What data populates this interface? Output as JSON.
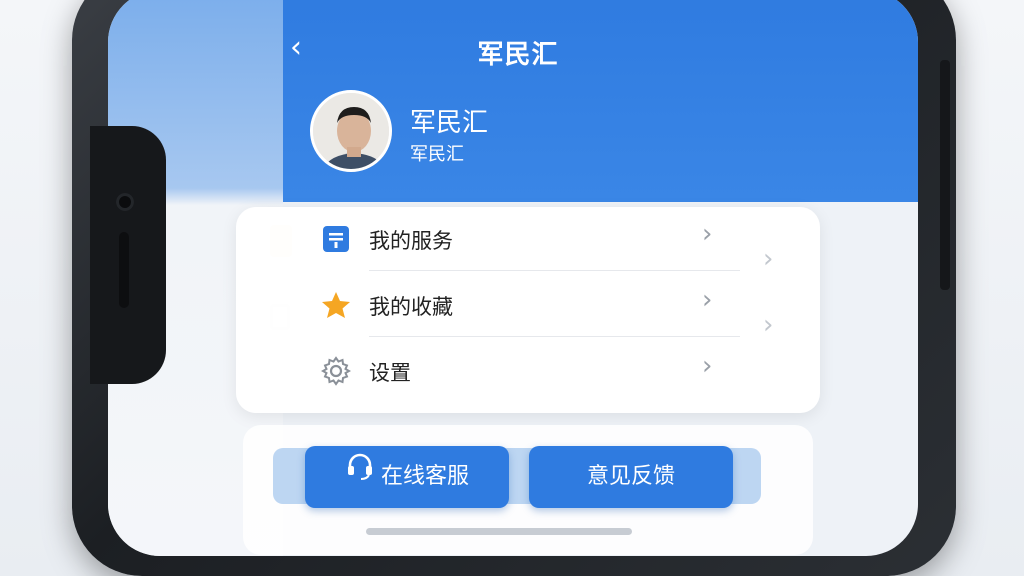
{
  "header": {
    "back_glyph": "‹",
    "title": "军民汇"
  },
  "profile": {
    "name": "军民汇",
    "subtitle": "军民汇"
  },
  "menu": {
    "items": [
      {
        "label": "我的服务",
        "icon": "service-list-icon",
        "chevron": "›"
      },
      {
        "label": "我的收藏",
        "icon": "star-icon",
        "chevron": "›"
      },
      {
        "label": "设置",
        "icon": "gear-icon",
        "chevron": "›"
      }
    ]
  },
  "actions": {
    "customer_service": "在线客服",
    "feedback": "意见反馈"
  },
  "colors": {
    "accent": "#2F7BE0",
    "star": "#F5A623",
    "text": "#222222"
  }
}
